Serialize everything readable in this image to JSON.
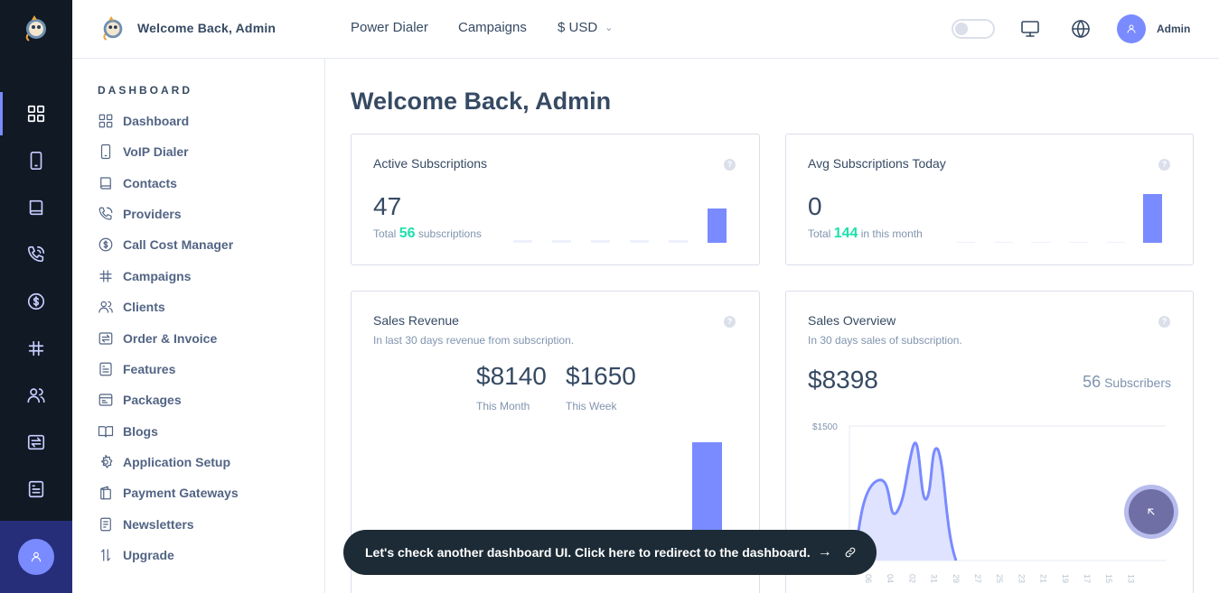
{
  "header": {
    "title": "Welcome Back, Admin",
    "nav": [
      {
        "label": "Power Dialer"
      },
      {
        "label": "Campaigns"
      }
    ],
    "currency": "$ USD",
    "user_name": "Admin"
  },
  "sidebar": {
    "heading": "DASHBOARD",
    "items": [
      {
        "label": "Dashboard",
        "icon": "grid-icon"
      },
      {
        "label": "VoIP Dialer",
        "icon": "mobile-icon"
      },
      {
        "label": "Contacts",
        "icon": "book-icon"
      },
      {
        "label": "Providers",
        "icon": "phone-icon"
      },
      {
        "label": "Call Cost Manager",
        "icon": "dollar-icon"
      },
      {
        "label": "Campaigns",
        "icon": "hash-icon"
      },
      {
        "label": "Clients",
        "icon": "users-icon"
      },
      {
        "label": "Order & Invoice",
        "icon": "swap-icon"
      },
      {
        "label": "Features",
        "icon": "list-icon"
      },
      {
        "label": "Packages",
        "icon": "package-icon"
      },
      {
        "label": "Blogs",
        "icon": "open-book-icon"
      },
      {
        "label": "Application Setup",
        "icon": "gear-icon"
      },
      {
        "label": "Payment Gateways",
        "icon": "wallet-icon"
      },
      {
        "label": "Newsletters",
        "icon": "newsletter-icon"
      },
      {
        "label": "Upgrade",
        "icon": "upgrade-icon"
      }
    ]
  },
  "main": {
    "title": "Welcome Back, Admin",
    "active_subscriptions": {
      "title": "Active Subscriptions",
      "value": "47",
      "total_prefix": "Total",
      "total_value": "56",
      "total_suffix": "subscriptions",
      "mini_bars": [
        0,
        0,
        0,
        0,
        0,
        1
      ]
    },
    "avg_subscriptions": {
      "title": "Avg Subscriptions Today",
      "value": "0",
      "total_prefix": "Total",
      "total_value": "144",
      "total_suffix": "in this month",
      "mini_bars": [
        0,
        0,
        0,
        0,
        0,
        1
      ]
    },
    "sales_revenue": {
      "title": "Sales Revenue",
      "subtitle": "In last 30 days revenue from subscription.",
      "month_value": "$8140",
      "month_label": "This Month",
      "week_value": "$1650",
      "week_label": "This Week"
    },
    "sales_overview": {
      "title": "Sales Overview",
      "subtitle": "In 30 days sales of subscription.",
      "value": "$8398",
      "subscribers_count": "56",
      "subscribers_label": "Subscribers",
      "y_tick": "$1500",
      "x_ticks": [
        "06",
        "04",
        "02",
        "31",
        "29",
        "27",
        "25",
        "23",
        "21",
        "19",
        "17",
        "15",
        "13"
      ]
    }
  },
  "toast": {
    "text": "Let's check another dashboard UI. Click here to redirect to the dashboard.",
    "arrow": "→"
  },
  "colors": {
    "accent": "#798bff",
    "success": "#1ee0ac",
    "rail_bg": "#101924",
    "toast_bg": "#1c2b36"
  }
}
